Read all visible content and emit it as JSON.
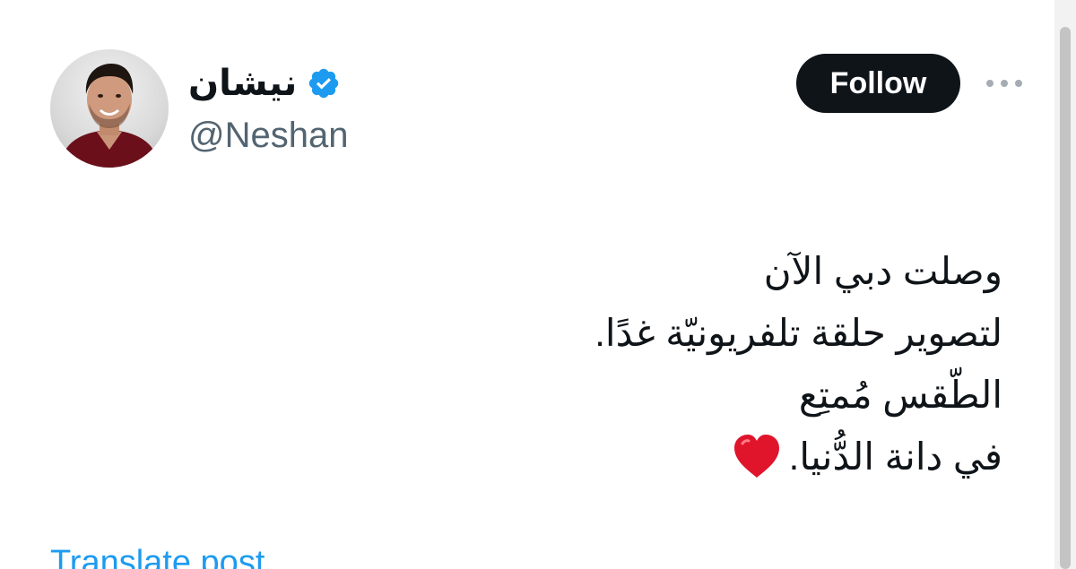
{
  "author": {
    "display_name": "نيشان",
    "handle": "@Neshan",
    "verified": true,
    "verified_icon": "verified-badge-icon",
    "avatar_icon": "profile-photo"
  },
  "actions": {
    "follow_label": "Follow",
    "more_icon": "more-dots-icon"
  },
  "tweet": {
    "lines": [
      "وصلت دبي الآن",
      "لتصوير حلقة تلفريونيّة غدًا.",
      "الطّقس مُمتِع",
      "في دانة الدُّنيا."
    ],
    "emoji": "red-heart-icon"
  },
  "translate_label": "Translate post",
  "colors": {
    "verified_blue": "#1d9bf0",
    "follow_bg": "#0f1419",
    "handle_gray": "#536471",
    "link_blue": "#1d9bf0",
    "heart_red": "#e0142b"
  }
}
